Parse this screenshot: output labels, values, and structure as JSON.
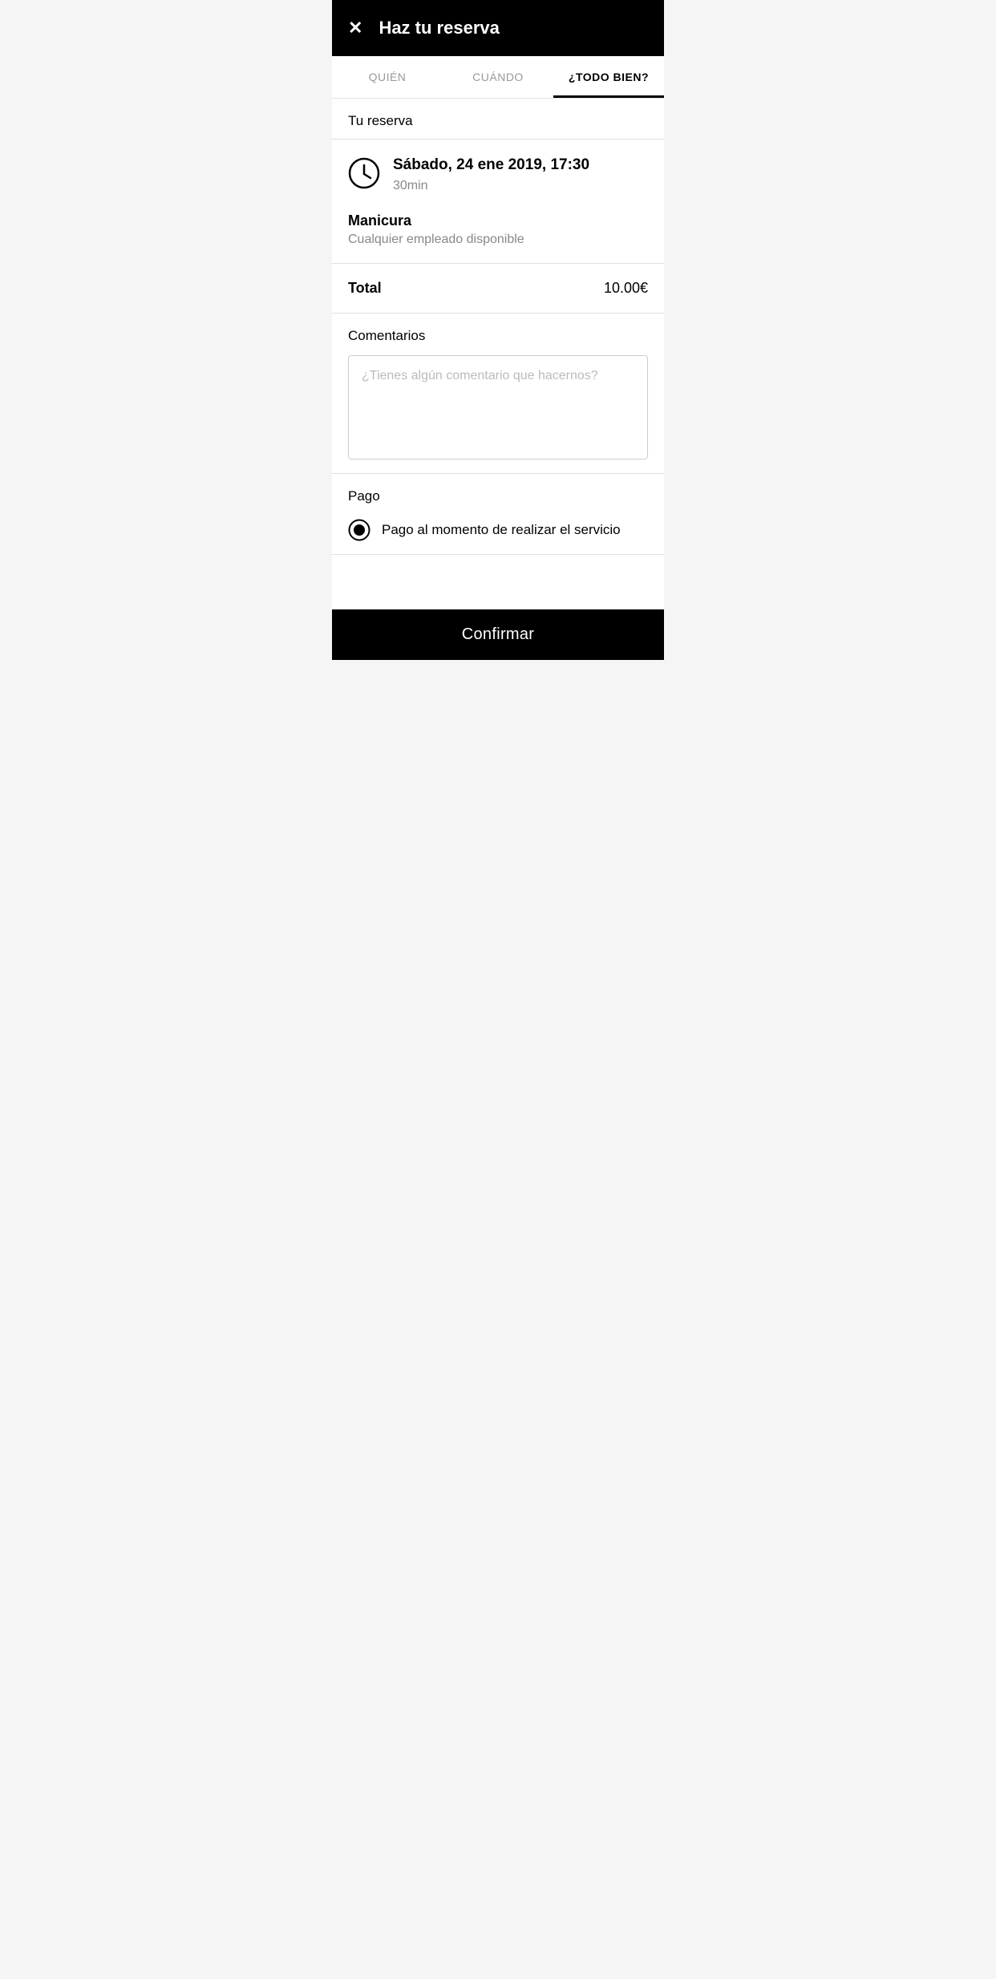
{
  "header": {
    "close_label": "✕",
    "title": "Haz tu reserva"
  },
  "tabs": [
    {
      "id": "quien",
      "label": "QUIÉN",
      "active": false
    },
    {
      "id": "cuando",
      "label": "CUÁNDO",
      "active": false
    },
    {
      "id": "todo_bien",
      "label": "¿TODO BIEN?",
      "active": true
    }
  ],
  "reservation": {
    "section_title": "Tu reserva",
    "datetime": "Sábado, 24 ene 2019, 17:30",
    "duration": "30min",
    "service_name": "Manicura",
    "service_employee": "Cualquier empleado disponible",
    "total_label": "Total",
    "total_amount": "10.00€"
  },
  "comments": {
    "label": "Comentarios",
    "placeholder": "¿Tienes algún comentario que hacernos?"
  },
  "payment": {
    "label": "Pago",
    "option_text": "Pago al momento de realizar el servicio"
  },
  "footer": {
    "confirm_label": "Confirmar"
  }
}
